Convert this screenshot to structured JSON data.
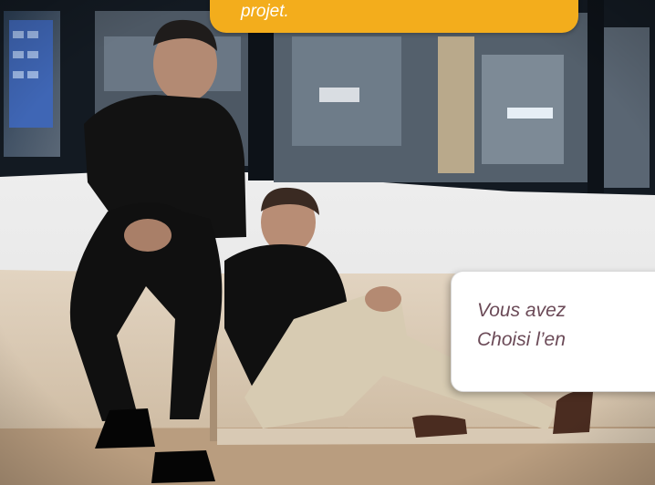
{
  "top_callout": {
    "text": "projet."
  },
  "right_callout": {
    "line1": "Vous avez",
    "line2": "Choisi l’en"
  },
  "colors": {
    "callout_accent": "#f3ad1c",
    "callout_text": "#6b4a57",
    "frame_dark": "#131a22"
  }
}
